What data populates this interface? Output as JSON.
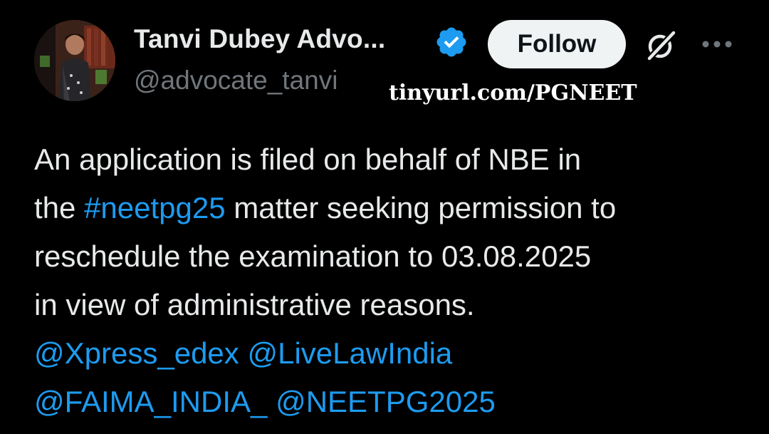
{
  "author": {
    "display_name": "Tanvi Dubey Advo...",
    "handle": "@advocate_tanvi",
    "verified": true
  },
  "actions": {
    "follow_label": "Follow",
    "grok_icon": "grok-icon",
    "more_icon": "more-icon"
  },
  "watermark": "tinyurl.com/PGNEET",
  "tweet": {
    "line1": "An application is filed on behalf of NBE in",
    "line2_prefix": "the ",
    "hashtag": "#neetpg25",
    "line2_suffix": " matter seeking permission to",
    "line3": "reschedule the examination to 03.08.2025",
    "line4": "in view of administrative reasons.",
    "mentions": [
      "@Xpress_edex",
      "@LiveLawIndia",
      "@FAIMA_INDIA_",
      "@NEETPG2025"
    ]
  },
  "colors": {
    "background": "#000000",
    "text": "#e7e9ea",
    "secondary": "#71767b",
    "link": "#1d9bf0",
    "verified": "#1d9bf0",
    "button_bg": "#eff3f4"
  }
}
